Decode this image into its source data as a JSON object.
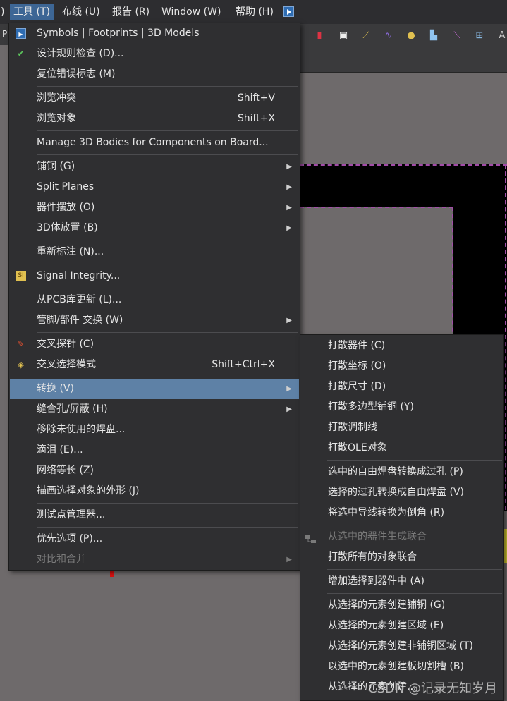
{
  "menubar": {
    "partial_left": ")",
    "items": [
      "工具 (T)",
      "布线 (U)",
      "报告 (R)",
      "Window (W)",
      "帮助 (H)"
    ]
  },
  "tab_partial": "P",
  "menu": {
    "items": [
      {
        "label": "Symbols | Footprints | 3D Models",
        "icon": "play-square-icon"
      },
      {
        "label": "设计规则检查 (D)...",
        "icon": "drc-check-icon"
      },
      {
        "label": "复位错误标志 (M)"
      },
      {
        "label": "浏览冲突",
        "shortcut": "Shift+V"
      },
      {
        "label": "浏览对象",
        "shortcut": "Shift+X"
      },
      {
        "label": "Manage 3D Bodies for Components on Board..."
      },
      {
        "label": "铺铜 (G)",
        "submenu": true
      },
      {
        "label": "Split Planes",
        "submenu": true
      },
      {
        "label": "器件摆放 (O)",
        "submenu": true
      },
      {
        "label": "3D体放置 (B)",
        "submenu": true
      },
      {
        "label": "重新标注 (N)..."
      },
      {
        "label": "Signal Integrity...",
        "icon": "signal-integrity-icon"
      },
      {
        "label": "从PCB库更新 (L)..."
      },
      {
        "label": "管脚/部件 交换 (W)",
        "submenu": true
      },
      {
        "label": "交叉探针 (C)",
        "icon": "cross-probe-icon"
      },
      {
        "label": "交叉选择模式",
        "shortcut": "Shift+Ctrl+X",
        "icon": "cross-select-icon"
      },
      {
        "label": "转换 (V)",
        "submenu": true
      },
      {
        "label": "缝合孔/屏蔽 (H)",
        "submenu": true
      },
      {
        "label": "移除未使用的焊盘..."
      },
      {
        "label": "滴泪 (E)..."
      },
      {
        "label": "网络等长 (Z)"
      },
      {
        "label": "描画选择对象的外形 (J)"
      },
      {
        "label": "测试点管理器..."
      },
      {
        "label": "优先选项 (P)..."
      },
      {
        "label": "对比和合并",
        "submenu": true
      }
    ]
  },
  "submenu": {
    "items": [
      {
        "label": "打散器件 (C)"
      },
      {
        "label": "打散坐标 (O)"
      },
      {
        "label": "打散尺寸 (D)"
      },
      {
        "label": "打散多边型铺铜 (Y)"
      },
      {
        "label": "打散调制线"
      },
      {
        "label": "打散OLE对象"
      },
      {
        "label": "选中的自由焊盘转换成过孔 (P)"
      },
      {
        "label": "选择的过孔转换成自由焊盘 (V)"
      },
      {
        "label": "将选中导线转换为倒角 (R)"
      },
      {
        "label": "从选中的器件生成联合"
      },
      {
        "label": "打散所有的对象联合"
      },
      {
        "label": "增加选择到器件中 (A)"
      },
      {
        "label": "从选择的元素创建铺铜 (G)"
      },
      {
        "label": "从选择的元素创建区域 (E)"
      },
      {
        "label": "从选择的元素创建非铺铜区域 (T)"
      },
      {
        "label": "以选中的元素创建板切割槽 (B)"
      },
      {
        "label": "从选择的元素创建..."
      }
    ]
  },
  "watermark": "CSDN @记录无知岁月",
  "colors": {
    "highlight": "#5e81a6",
    "menu_bg": "#2f2f31",
    "board_outline": "#a24ca8"
  }
}
